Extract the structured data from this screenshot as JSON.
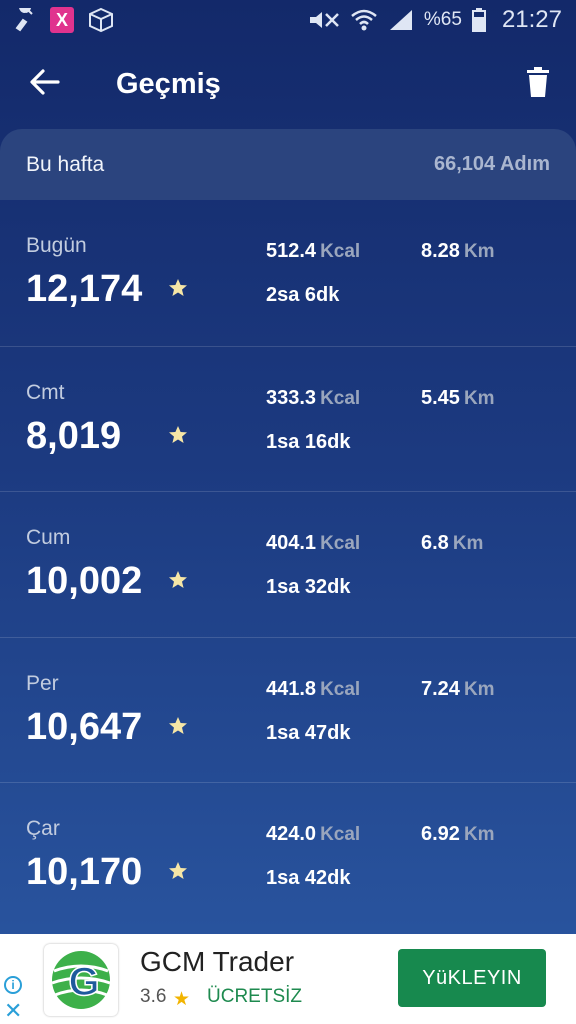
{
  "status_bar": {
    "battery_percent": "%65",
    "time": "21:27",
    "left_icons": [
      "tool-icon",
      "x-app-icon",
      "package-icon"
    ],
    "right_icons": [
      "mute-icon",
      "wifi-icon",
      "signal-icon",
      "battery-icon"
    ]
  },
  "header": {
    "title": "Geçmiş",
    "back_icon": "back-arrow-icon",
    "delete_icon": "trash-icon"
  },
  "week": {
    "label": "Bu hafta",
    "total": "66,104 Adım"
  },
  "units": {
    "kcal": "Kcal",
    "km": "Km"
  },
  "days": [
    {
      "name": "Bugün",
      "steps": "12,174",
      "kcal": "512.4",
      "km": "8.28",
      "duration": "2sa 6dk"
    },
    {
      "name": "Cmt",
      "steps": "8,019",
      "kcal": "333.3",
      "km": "5.45",
      "duration": "1sa 16dk"
    },
    {
      "name": "Cum",
      "steps": "10,002",
      "kcal": "404.1",
      "km": "6.8",
      "duration": "1sa 32dk"
    },
    {
      "name": "Per",
      "steps": "10,647",
      "kcal": "441.8",
      "km": "7.24",
      "duration": "1sa 47dk"
    },
    {
      "name": "Çar",
      "steps": "10,170",
      "kcal": "424.0",
      "km": "6.92",
      "duration": "1sa 42dk"
    }
  ],
  "ad": {
    "app_name": "GCM Trader",
    "rating": "3.6",
    "price": "ÜCRETSİZ",
    "install_label": "YüKLEYIN",
    "colors": {
      "install_button": "#17894e",
      "free_text": "#1e8a4f"
    }
  },
  "colors": {
    "background_top": "#13296a",
    "background_bottom": "#2b58a3",
    "star": "#f6e6a6"
  }
}
